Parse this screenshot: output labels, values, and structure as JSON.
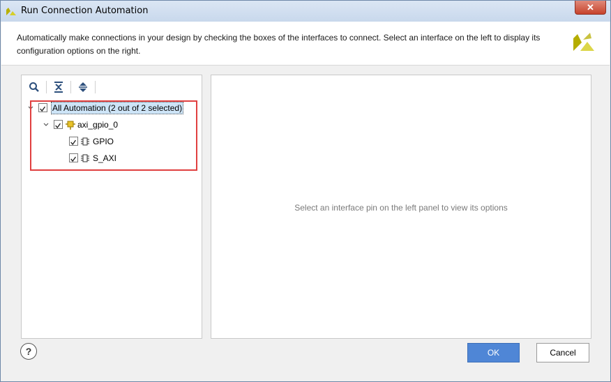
{
  "window": {
    "title": "Run Connection Automation"
  },
  "description": "Automatically make connections in your design by checking the boxes of the interfaces to connect. Select an interface on the left to display its configuration options on the right.",
  "toolbar": {
    "icons": [
      "search-icon",
      "collapse-all-icon",
      "expand-all-icon"
    ]
  },
  "tree": {
    "root": {
      "label": "All Automation (2 out of 2 selected)",
      "checked": true,
      "expanded": true
    },
    "node": {
      "label": "axi_gpio_0",
      "checked": true,
      "expanded": true
    },
    "pins": [
      {
        "label": "GPIO",
        "checked": true
      },
      {
        "label": "S_AXI",
        "checked": true
      }
    ]
  },
  "right_panel": {
    "message": "Select an interface pin on the left panel to view its options"
  },
  "buttons": {
    "help": "?",
    "ok": "OK",
    "cancel": "Cancel"
  },
  "colors": {
    "accent": "#4f86d6",
    "highlight_border": "#e04040",
    "selection": "#cde4f7"
  }
}
